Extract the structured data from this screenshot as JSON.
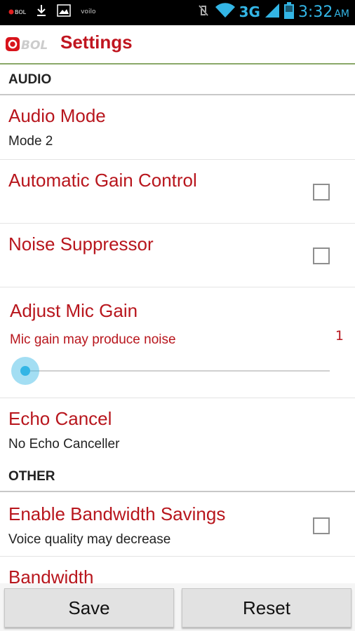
{
  "status_bar": {
    "left_icons": [
      "bol-notification-icon",
      "download-icon",
      "image-icon",
      "voila-icon"
    ],
    "bol_text": "BOL",
    "voila_text": "voilo",
    "network": "3G",
    "time": "3:32",
    "ampm": "AM"
  },
  "action_bar": {
    "logo_text": "BOL",
    "title": "Settings"
  },
  "audio_section": {
    "header": "AUDIO",
    "audio_mode": {
      "title": "Audio Mode",
      "summary": "Mode 2"
    },
    "agc": {
      "title": "Automatic Gain Control",
      "checked": false
    },
    "noise": {
      "title": "Noise Suppressor",
      "checked": false
    },
    "mic_gain": {
      "title": "Adjust Mic Gain",
      "summary": "Mic gain may produce noise",
      "value": "1"
    },
    "echo": {
      "title": "Echo Cancel",
      "summary": "No Echo Canceller"
    }
  },
  "other_section": {
    "header": "OTHER",
    "bandwidth_savings": {
      "title": "Enable Bandwidth Savings",
      "summary": "Voice quality may decrease",
      "checked": false
    },
    "bandwidth": {
      "title": "Bandwidth"
    }
  },
  "buttons": {
    "save": "Save",
    "reset": "Reset"
  },
  "colors": {
    "accent": "#b8161d",
    "holo_blue": "#33b5e5"
  }
}
